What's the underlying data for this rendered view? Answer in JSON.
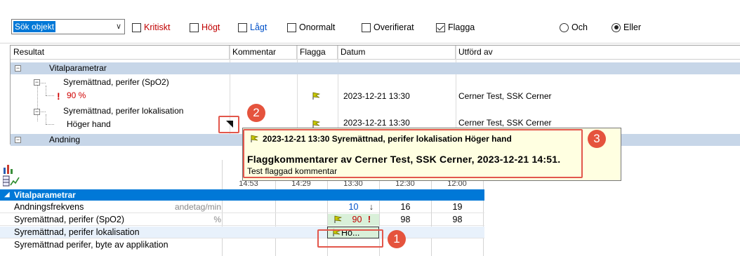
{
  "filters": {
    "search_value": "Sök objekt",
    "checkboxes": [
      {
        "label": "Kritiskt",
        "checked": false,
        "color": "#c00000"
      },
      {
        "label": "Högt",
        "checked": false,
        "color": "#c00000"
      },
      {
        "label": "Lågt",
        "checked": false,
        "color": "#0050c8"
      },
      {
        "label": "Onormalt",
        "checked": false,
        "color": "#000000"
      },
      {
        "label": "Overifierat",
        "checked": false,
        "color": "#000000"
      },
      {
        "label": "Flagga",
        "checked": true,
        "color": "#000000"
      }
    ],
    "radios": [
      {
        "label": "Och",
        "selected": false
      },
      {
        "label": "Eller",
        "selected": true
      }
    ]
  },
  "results": {
    "columns": [
      "Resultat",
      "Kommentar",
      "Flagga",
      "Datum",
      "Utförd av"
    ],
    "groups": {
      "vital": "Vitalparametrar",
      "andning": "Andning"
    },
    "items": {
      "spo2_label": "Syremättnad, perifer (SpO2)",
      "spo2_value": "90 %",
      "spo2_alert": "!",
      "spo2_date": "2023-12-21 13:30",
      "spo2_by": "Cerner Test, SSK Cerner",
      "lok_label": "Syremättnad, perifer lokalisation",
      "lok_value": "Höger hand",
      "lok_date": "2023-12-21 13:30",
      "lok_by": "Cerner Test, SSK Cerner"
    }
  },
  "tooltip": {
    "line1": "2023-12-21 13:30 Syremättnad, perifer lokalisation Höger hand",
    "line2": "Flaggkommentarer av Cerner Test, SSK Cerner, 2023-12-21 14:51.",
    "line3": "Test flaggad kommentar"
  },
  "flowsheet": {
    "times": [
      "14:53",
      "14:29",
      "13:30",
      "12:30",
      "12:00"
    ],
    "section": "Vitalparametrar",
    "rows": [
      {
        "name": "Andningsfrekvens",
        "unit": "andetag/min",
        "values": [
          "",
          "",
          "10",
          "16",
          "19"
        ]
      },
      {
        "name": "Syremättnad, perifer (SpO2)",
        "unit": "%",
        "values": [
          "",
          "",
          "90",
          "98",
          "98"
        ]
      },
      {
        "name": "Syremättnad, perifer lokalisation",
        "unit": "",
        "values": [
          "",
          "",
          "Hö...",
          "",
          ""
        ]
      },
      {
        "name": "Syremättnad perifer, byte av applikation",
        "unit": "",
        "values": [
          "",
          "",
          "",
          "",
          ""
        ]
      }
    ],
    "rf_trend": "↓",
    "spo2_alert": "!"
  },
  "callouts": [
    "1",
    "2",
    "3"
  ],
  "colors": {
    "accent": "#0078d7",
    "group_bg": "#c7d6e8",
    "tooltip_bg": "#ffffe1",
    "callout": "#e5533d"
  }
}
